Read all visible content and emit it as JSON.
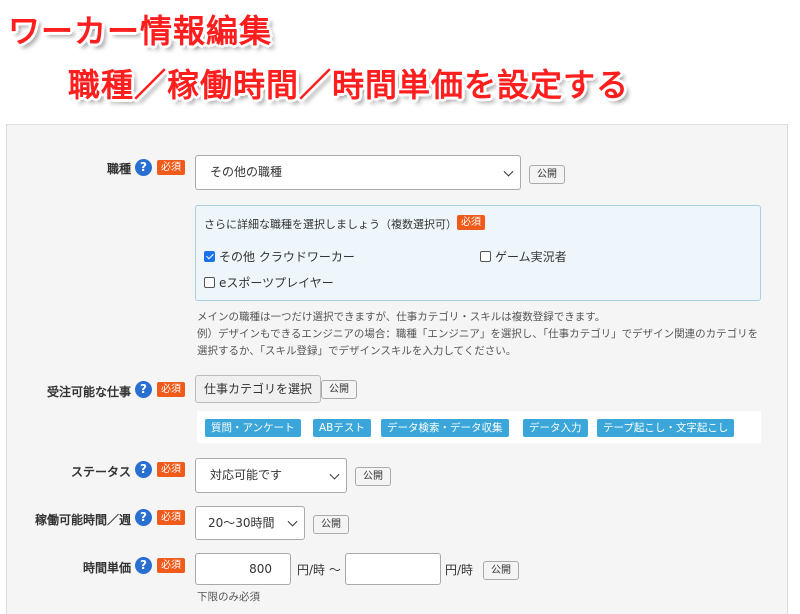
{
  "banner": {
    "line1": "ワーカー情報編集",
    "line2": "職種／稼働時間／時間単価を設定する"
  },
  "common": {
    "required": "必須",
    "public": "公開",
    "help": "?"
  },
  "occupation": {
    "label": "職種",
    "selected": "その他の職種",
    "detail": {
      "title": "さらに詳細な職種を選択しましょう（複数選択可）",
      "options": [
        {
          "label": "その他 クラウドワーカー",
          "checked": true
        },
        {
          "label": "ゲーム実況者",
          "checked": false
        },
        {
          "label": "eスポーツプレイヤー",
          "checked": false
        }
      ]
    },
    "note": "メインの職種は一つだけ選択できますが、仕事カテゴリ・スキルは複数登録できます。\n例）デザインもできるエンジニアの場合：職種「エンジニア」を選択し、「仕事カテゴリ」でデザイン関連のカテゴリを選択するか、「スキル登録」でデザインスキルを入力してください。"
  },
  "jobs": {
    "label": "受注可能な仕事",
    "button": "仕事カテゴリを選択",
    "tags": [
      "質問・アンケート",
      "ABテスト",
      "データ検索・データ収集",
      "データ入力",
      "テープ起こし・文字起こし"
    ]
  },
  "status": {
    "label": "ステータス",
    "selected": "対応可能です"
  },
  "hours": {
    "label": "稼働可能時間／週",
    "selected": "20〜30時間"
  },
  "rate": {
    "label": "時間単価",
    "min": "800",
    "max": "",
    "unit1": "円/時 〜",
    "unit2": "円/時",
    "note": "下限のみ必須"
  },
  "colors": {
    "banner_text": "#ff1e1e",
    "help_icon": "#2a6fd0",
    "required_badge": "#f05a1a",
    "tag": "#3ba6d9",
    "detail_bg": "#eef6fb"
  }
}
